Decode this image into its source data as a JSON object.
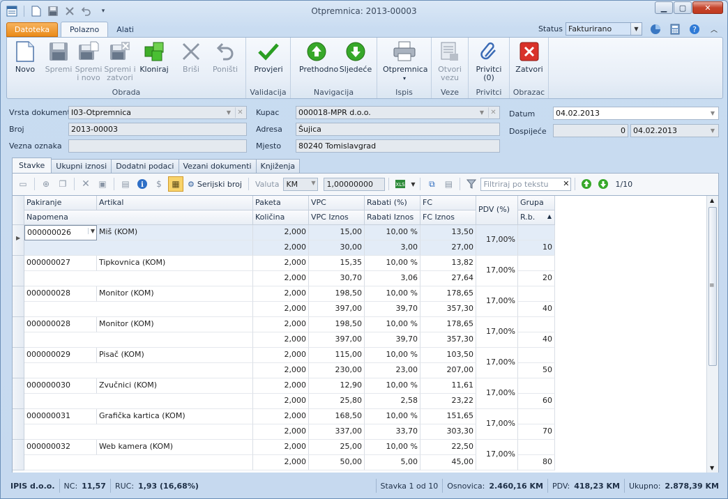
{
  "window": {
    "title": "Otpremnica: 2013-00003"
  },
  "ribbon_tabs": [
    "Datoteka",
    "Polazno",
    "Alati"
  ],
  "status": {
    "label": "Status",
    "value": "Fakturirano"
  },
  "ribbon": {
    "groups": [
      {
        "label": "Obrada",
        "buttons": [
          "Novo",
          "Spremi",
          "Spremi i novo",
          "Spremi i zatvori",
          "Kloniraj",
          "Briši",
          "Poništi"
        ]
      },
      {
        "label": "Validacija",
        "buttons": [
          "Provjeri"
        ]
      },
      {
        "label": "Navigacija",
        "buttons": [
          "Prethodno",
          "Sljedeće"
        ]
      },
      {
        "label": "Ispis",
        "buttons": [
          "Otpremnica"
        ]
      },
      {
        "label": "Veze",
        "buttons": [
          "Otvori vezu"
        ]
      },
      {
        "label": "Privitci",
        "buttons": [
          "Privitci (0)"
        ]
      },
      {
        "label": "Obrazac",
        "buttons": [
          "Zatvori"
        ]
      }
    ],
    "btn": {
      "novo": "Novo",
      "spremi": "Spremi",
      "spremi_novo_1": "Spremi",
      "spremi_novo_2": "i novo",
      "spremi_zatv_1": "Spremi i",
      "spremi_zatv_2": "zatvori",
      "kloniraj": "Kloniraj",
      "brisi": "Briši",
      "ponisti": "Poništi",
      "provjeri": "Provjeri",
      "prethodno": "Prethodno",
      "sljedece": "Sljedeće",
      "otpremnica": "Otpremnica",
      "otvori_1": "Otvori",
      "otvori_2": "vezu",
      "privitci_1": "Privitci",
      "privitci_2": "(0)",
      "zatvori": "Zatvori"
    },
    "grp": {
      "obrada": "Obrada",
      "validacija": "Validacija",
      "navigacija": "Navigacija",
      "ispis": "Ispis",
      "veze": "Veze",
      "privitci": "Privitci",
      "obrazac": "Obrazac"
    }
  },
  "form": {
    "vrsta_lbl": "Vrsta dokumenta",
    "vrsta": "I03-Otpremnica",
    "broj_lbl": "Broj",
    "broj": "2013-00003",
    "vezna_lbl": "Vezna oznaka",
    "vezna": "",
    "kupac_lbl": "Kupac",
    "kupac": "000018-MPR d.o.o.",
    "adresa_lbl": "Adresa",
    "adresa": "Šujica",
    "mjesto_lbl": "Mjesto",
    "mjesto": "80240 Tomislavgrad",
    "datum_lbl": "Datum",
    "datum": "04.02.2013",
    "dospijece_lbl": "Dospijeće",
    "dospijece_dani": "0",
    "dospijece": "04.02.2013"
  },
  "detail_tabs": [
    "Stavke",
    "Ukupni iznosi",
    "Dodatni podaci",
    "Vezani dokumenti",
    "Knjiženja"
  ],
  "toolbar": {
    "serijski": "Serijski broj",
    "valuta_lbl": "Valuta",
    "valuta": "KM",
    "tecaj": "1,00000000",
    "filter_placeholder": "Filtriraj po tekstu",
    "pager": "1/10"
  },
  "grid": {
    "headers_top": [
      "Pakiranje",
      "Artikal",
      "Paketa",
      "VPC",
      "Rabati (%)",
      "FC",
      "PDV (%)",
      "Grupa"
    ],
    "headers_bottom": [
      "Napomena",
      "Količina",
      "VPC Iznos",
      "Rabati Iznos",
      "FC Iznos",
      "R.b."
    ],
    "rows": [
      {
        "pak": "000000026",
        "art": "Miš (KOM)",
        "paketa": "2,000",
        "vpc": "15,00",
        "rab": "10,00 %",
        "fc": "13,50",
        "kol": "2,000",
        "vpci": "30,00",
        "rabi": "3,00",
        "fci": "27,00",
        "pdv": "17,00%",
        "rb": "10"
      },
      {
        "pak": "000000027",
        "art": "Tipkovnica (KOM)",
        "paketa": "2,000",
        "vpc": "15,35",
        "rab": "10,00 %",
        "fc": "13,82",
        "kol": "2,000",
        "vpci": "30,70",
        "rabi": "3,06",
        "fci": "27,64",
        "pdv": "17,00%",
        "rb": "20"
      },
      {
        "pak": "000000028",
        "art": "Monitor (KOM)",
        "paketa": "2,000",
        "vpc": "198,50",
        "rab": "10,00 %",
        "fc": "178,65",
        "kol": "2,000",
        "vpci": "397,00",
        "rabi": "39,70",
        "fci": "357,30",
        "pdv": "17,00%",
        "rb": "40"
      },
      {
        "pak": "000000028",
        "art": "Monitor (KOM)",
        "paketa": "2,000",
        "vpc": "198,50",
        "rab": "10,00 %",
        "fc": "178,65",
        "kol": "2,000",
        "vpci": "397,00",
        "rabi": "39,70",
        "fci": "357,30",
        "pdv": "17,00%",
        "rb": "40"
      },
      {
        "pak": "000000029",
        "art": "Pisač (KOM)",
        "paketa": "2,000",
        "vpc": "115,00",
        "rab": "10,00 %",
        "fc": "103,50",
        "kol": "2,000",
        "vpci": "230,00",
        "rabi": "23,00",
        "fci": "207,00",
        "pdv": "17,00%",
        "rb": "50"
      },
      {
        "pak": "000000030",
        "art": "Zvučnici (KOM)",
        "paketa": "2,000",
        "vpc": "12,90",
        "rab": "10,00 %",
        "fc": "11,61",
        "kol": "2,000",
        "vpci": "25,80",
        "rabi": "2,58",
        "fci": "23,22",
        "pdv": "17,00%",
        "rb": "60"
      },
      {
        "pak": "000000031",
        "art": "Grafička kartica (KOM)",
        "paketa": "2,000",
        "vpc": "168,50",
        "rab": "10,00 %",
        "fc": "151,65",
        "kol": "2,000",
        "vpci": "337,00",
        "rabi": "33,70",
        "fci": "303,30",
        "pdv": "17,00%",
        "rb": "70"
      },
      {
        "pak": "000000032",
        "art": "Web kamera (KOM)",
        "paketa": "2,000",
        "vpc": "25,00",
        "rab": "10,00 %",
        "fc": "22,50",
        "kol": "2,000",
        "vpci": "50,00",
        "rabi": "5,00",
        "fci": "45,00",
        "pdv": "17,00%",
        "rb": "80"
      }
    ]
  },
  "statusbar": {
    "company": "IPIS d.o.o.",
    "nc_lbl": "NC:",
    "nc": "11,57",
    "ruc_lbl": "RUC:",
    "ruc": "1,93 (16,68%)",
    "stavka": "Stavka 1 od 10",
    "osnovica_lbl": "Osnovica:",
    "osnovica": "2.460,16 KM",
    "pdv_lbl": "PDV:",
    "pdv": "418,23 KM",
    "ukupno_lbl": "Ukupno:",
    "ukupno": "2.878,39 KM"
  },
  "colors": {
    "accent_orange": "#ea8a19",
    "ribbon_bg": "#dbe6f2",
    "selected_row": "#e3ecf7"
  }
}
